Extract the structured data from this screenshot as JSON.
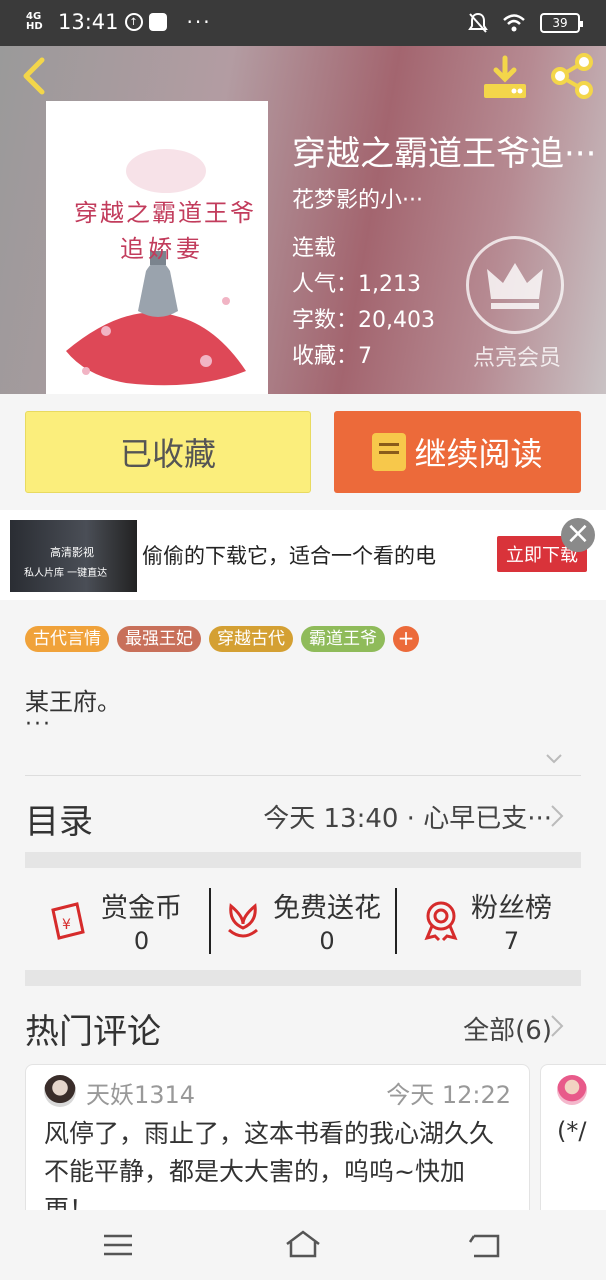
{
  "status_bar": {
    "network": "4G HD",
    "time": "13:41",
    "dots": "···",
    "battery": "39"
  },
  "book": {
    "title": "穿越之霸道王爷追···",
    "cover_title_line1": "穿越之霸道王爷",
    "cover_title_line2": "追娇妻",
    "author": "花梦影的小···",
    "status": "连载",
    "popularity": "人气：1,213",
    "word_count": "字数：20,403",
    "favorites": "收藏：7",
    "vip_label": "点亮会员"
  },
  "actions": {
    "favorited_label": "已收藏",
    "continue_label": "继续阅读"
  },
  "ad": {
    "img_text1": "高清影视",
    "img_text2": "私人片库 一键直达",
    "text": "偷偷的下载它，适合一个看的电",
    "button": "立即下载",
    "close": "×"
  },
  "tags": [
    {
      "label": "古代言情",
      "color": "#f0a23a"
    },
    {
      "label": "最强王妃",
      "color": "#c8705a"
    },
    {
      "label": "穿越古代",
      "color": "#d4a033"
    },
    {
      "label": "霸道王爷",
      "color": "#8fbb5a"
    }
  ],
  "tag_add": "+",
  "description": {
    "text": "某王府。",
    "more": "···"
  },
  "toc": {
    "label": "目录",
    "latest": "今天 13:40 · 心早已支···"
  },
  "rewards": [
    {
      "label": "赏金币",
      "count": "0",
      "icon": "red-envelope-icon"
    },
    {
      "label": "免费送花",
      "count": "0",
      "icon": "flower-icon"
    },
    {
      "label": "粉丝榜",
      "count": "7",
      "icon": "medal-icon"
    }
  ],
  "comments": {
    "label": "热门评论",
    "all": "全部(6)",
    "items": [
      {
        "user": "天妖1314",
        "time": "今天 12:22",
        "text": "风停了，雨止了，这本书看的我心湖久久不能平静，都是大大害的，呜呜~快加更！"
      },
      {
        "text": "(*/"
      }
    ]
  },
  "colors": {
    "accent_orange": "#ec6a3a",
    "favorite_yellow": "#fbee7c"
  }
}
